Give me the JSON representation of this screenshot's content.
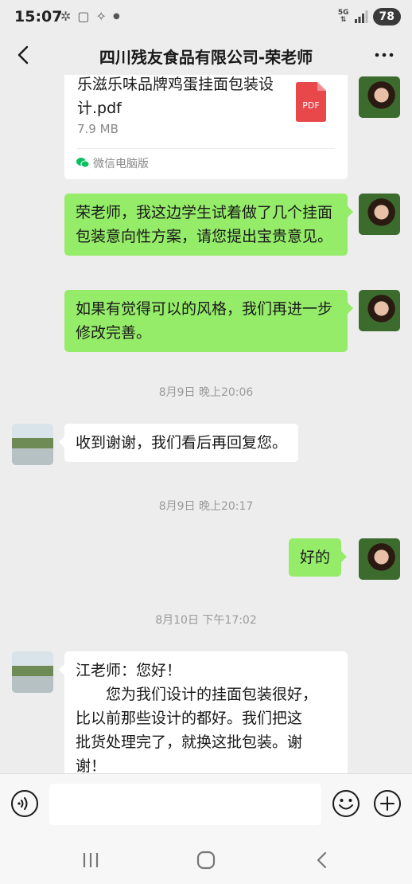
{
  "status_bar": {
    "time": "15:07",
    "network": "5G",
    "battery": "78"
  },
  "header": {
    "title": "四川残友食品有限公司-荣老师"
  },
  "messages": [
    {
      "type": "file",
      "sender": "me",
      "file_name": "乐滋乐味品牌鸡蛋挂面包装设计.pdf",
      "file_size": "7.9 MB",
      "file_type_label": "PDF",
      "source": "微信电脑版"
    },
    {
      "type": "text",
      "sender": "me",
      "text": "荣老师，我这边学生试着做了几个挂面包装意向性方案，请您提出宝贵意见。"
    },
    {
      "type": "text",
      "sender": "me",
      "text": "如果有觉得可以的风格，我们再进一步修改完善。"
    },
    {
      "type": "timestamp",
      "text": "8月9日 晚上20:06"
    },
    {
      "type": "text",
      "sender": "other",
      "text": "收到谢谢，我们看后再回复您。"
    },
    {
      "type": "timestamp",
      "text": "8月9日 晚上20:17"
    },
    {
      "type": "text",
      "sender": "me",
      "text": "好的"
    },
    {
      "type": "timestamp",
      "text": "8月10日 下午17:02"
    },
    {
      "type": "text",
      "sender": "other",
      "text_lines": [
        "江老师：您好！",
        "　　您为我们设计的挂面包装很好，",
        "比以前那些设计的都好。我们把这",
        "批货处理完了，就换这批包装。谢",
        "谢！"
      ]
    }
  ],
  "input": {
    "value": ""
  },
  "colors": {
    "bubble_me": "#95ec69",
    "bubble_other": "#ffffff",
    "background": "#ededed",
    "pdf_icon": "#e9484b"
  }
}
